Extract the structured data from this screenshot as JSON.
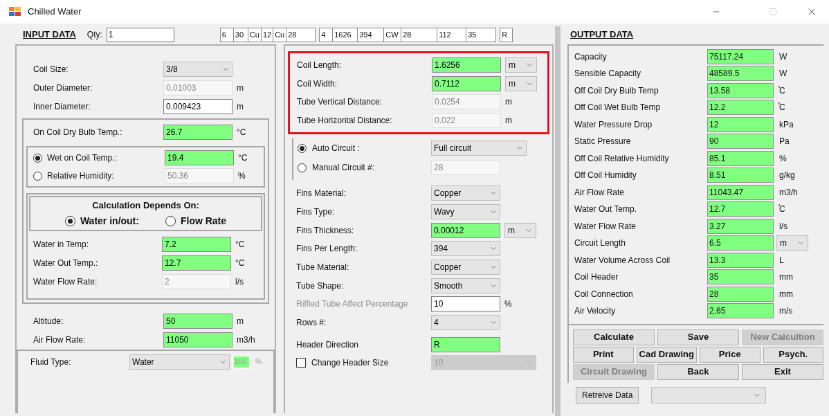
{
  "window": {
    "title": "Chilled Water"
  },
  "input_header": {
    "heading": "INPUT DATA",
    "qty_label": "Qty:",
    "qty_value": "1"
  },
  "code_strip": [
    [
      "6",
      "30",
      "Cu",
      "12",
      "Cu",
      "28"
    ],
    [
      "4",
      "1626",
      "394",
      "CW",
      "28",
      "112",
      "35"
    ],
    [
      "R"
    ]
  ],
  "left": {
    "geometry": [
      {
        "label": "Coil Size:",
        "field": {
          "value": "3/8",
          "kind": "select"
        }
      },
      {
        "label": "Outer Diameter:",
        "field": {
          "value": "0.01003",
          "kind": "disabled"
        },
        "unit": "m"
      },
      {
        "label": "Inner Diameter:",
        "field": {
          "value": "0.009423",
          "kind": "white"
        },
        "unit": "m"
      }
    ],
    "dry_bulb": {
      "label": "On Coil Dry Bulb Temp.:",
      "field": {
        "value": "26.7",
        "kind": "green"
      },
      "unit": "°C"
    },
    "humidity_options": [
      {
        "label": "Wet on Coil Temp.:",
        "selected": true,
        "field": {
          "value": "19.4",
          "kind": "green"
        },
        "unit": "°C"
      },
      {
        "label": "Relative Humidity:",
        "selected": false,
        "field": {
          "value": "50.36",
          "kind": "disabled"
        },
        "unit": "%"
      }
    ],
    "calculation": {
      "title": "Calculation Depends On:",
      "options": [
        {
          "label": "Water in/out:",
          "selected": true
        },
        {
          "label": "Flow Rate",
          "selected": false
        }
      ],
      "rows": [
        {
          "label": "Water in Temp:",
          "field": {
            "value": "7.2",
            "kind": "green"
          },
          "unit": "°C"
        },
        {
          "label": "Water Out Temp.:",
          "field": {
            "value": "12.7",
            "kind": "green"
          },
          "unit": "°C"
        },
        {
          "label": "Water Flow Rate:",
          "field": {
            "value": "2",
            "kind": "disabled"
          },
          "unit": "l/s"
        }
      ]
    },
    "air": [
      {
        "label": "Altitude:",
        "field": {
          "value": "50",
          "kind": "green"
        },
        "unit": "m"
      },
      {
        "label": "Air Flow Rate:",
        "field": {
          "value": "11050",
          "kind": "green"
        },
        "unit": "m3/h"
      }
    ],
    "fluid": {
      "label": "Fluid Type:",
      "field": {
        "value": "Water",
        "kind": "select"
      },
      "percent": "100",
      "unit": "%"
    }
  },
  "middle": {
    "dimensions": {
      "highlighted": true,
      "rows": [
        {
          "label": "Coil Length:",
          "field": {
            "value": "1.6256",
            "kind": "green"
          },
          "unit_select": "m"
        },
        {
          "label": "Coil Width:",
          "field": {
            "value": "0.7112",
            "kind": "green"
          },
          "unit_select": "m"
        },
        {
          "label": "Tube Vertical Distance:",
          "field": {
            "value": "0.0254",
            "kind": "disabled"
          },
          "unit": "m"
        },
        {
          "label": "Tube Horizontal Distance:",
          "field": {
            "value": "0.022",
            "kind": "disabled"
          },
          "unit": "m"
        }
      ]
    },
    "circuit": [
      {
        "label": "Auto Circuit :",
        "selected": true,
        "field": {
          "value": "Full circuit",
          "kind": "select"
        }
      },
      {
        "label": "Manual Circuit #:",
        "selected": false,
        "field": {
          "value": "28",
          "kind": "disabled"
        }
      }
    ],
    "rows": [
      {
        "label": "Fins Material:",
        "label_disabled": false,
        "field": {
          "value": "Copper",
          "kind": "select"
        }
      },
      {
        "label": "Fins Type:",
        "label_disabled": false,
        "field": {
          "value": "Wavy",
          "kind": "select"
        }
      },
      {
        "label": "Fins Thickness:",
        "label_disabled": false,
        "field": {
          "value": "0.00012",
          "kind": "green"
        },
        "unit_select": "m"
      },
      {
        "label": "Fins Per Length:",
        "label_disabled": false,
        "field": {
          "value": "394",
          "kind": "select"
        }
      },
      {
        "label": "Tube Material:",
        "label_disabled": false,
        "field": {
          "value": "Copper",
          "kind": "select"
        }
      },
      {
        "label": "Tube Shape:",
        "label_disabled": false,
        "field": {
          "value": "Smooth",
          "kind": "select"
        }
      },
      {
        "label": "Riffled Tube Affect Percentage",
        "label_disabled": true,
        "field": {
          "value": "10",
          "kind": "white"
        },
        "unit": "%"
      },
      {
        "label": "Rows #:",
        "label_disabled": false,
        "field": {
          "value": "4",
          "kind": "select"
        }
      },
      {
        "label": "Header Direction",
        "label_disabled": false,
        "field": {
          "value": "R",
          "kind": "green"
        }
      }
    ],
    "header_size": {
      "label": "Change Header Size",
      "checked": false,
      "field": {
        "value": "10",
        "kind": "select_disabled"
      }
    }
  },
  "output": {
    "heading": "OUTPUT DATA",
    "rows": [
      {
        "label": "Capacity",
        "value": "75117.24",
        "unit": "W"
      },
      {
        "label": "Sensible Capacity",
        "value": "48589.5",
        "unit": "W"
      },
      {
        "label": "Off Coil Dry Bulb Temp",
        "value": "13.58",
        "unit": "̊C"
      },
      {
        "label": "Off Coil Wet Bulb Temp",
        "value": "12.2",
        "unit": "̊C"
      },
      {
        "label": "Water Pressure Drop",
        "value": "12",
        "unit": "kPa"
      },
      {
        "label": "Static Pressure",
        "value": "90",
        "unit": "Pa"
      },
      {
        "label": "Off Coil Relative Humidity",
        "value": "85.1",
        "unit": "%"
      },
      {
        "label": "Off Coil Humidity",
        "value": "8.51",
        "unit": "g/kg"
      },
      {
        "label": "Air Flow Rate",
        "value": "11043.47",
        "unit": "m3/h"
      },
      {
        "label": "Water Out Temp.",
        "value": "12.7",
        "unit": "̊C"
      },
      {
        "label": "Water Flow Rate",
        "value": "3.27",
        "unit": "l/s"
      },
      {
        "label": "Circuit Length",
        "value": "6.5",
        "unit_select": "m"
      },
      {
        "label": "Water Volume Across Coil",
        "value": "13.3",
        "unit": "L"
      },
      {
        "label": "Coil Header",
        "value": "35",
        "unit": "mm"
      },
      {
        "label": "Coil Connection",
        "value": "28",
        "unit": "mm"
      },
      {
        "label": "Air Velocity",
        "value": "2.65",
        "unit": "m/s"
      }
    ]
  },
  "buttons": [
    [
      {
        "label": "Calculate",
        "disabled": false
      },
      {
        "label": "Save",
        "disabled": false
      },
      {
        "label": "New Calcultion",
        "disabled": true
      }
    ],
    [
      {
        "label": "Print",
        "disabled": false
      },
      {
        "label": "Cad Drawing",
        "disabled": false
      },
      {
        "label": "Price",
        "disabled": false
      },
      {
        "label": "Psych.",
        "disabled": false
      }
    ],
    [
      {
        "label": "Circuit Drawing",
        "disabled": true
      },
      {
        "label": "Back",
        "disabled": false
      },
      {
        "label": "Exit",
        "disabled": false
      }
    ]
  ],
  "retrieve": {
    "label": "Retreive Data"
  }
}
